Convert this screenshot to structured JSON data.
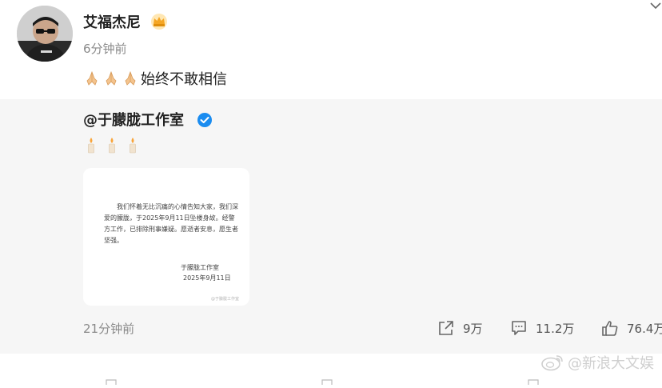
{
  "post": {
    "author": "艾福杰尼",
    "time": "6分钟前",
    "text": "始终不敢相信",
    "emoji_icons": [
      "folded-hands-icon",
      "folded-hands-icon",
      "folded-hands-icon"
    ]
  },
  "repost": {
    "author": "@于朦胧工作室",
    "candles": [
      "candle-icon",
      "candle-icon",
      "candle-icon"
    ],
    "card": {
      "body": "我们怀着无比沉痛的心情告知大家，我们深爱的朦胧，于2025年9月11日坠楼身故。经警方工作，已排除刑事嫌疑。愿逝者安息，愿生者坚强。",
      "signature": "于朦胧工作室",
      "date": "2025年9月11日",
      "watermark": "@于朦胧工作室"
    },
    "time": "21分钟前",
    "actions": {
      "share": "9万",
      "comment": "11.2万",
      "like": "76.4万"
    }
  },
  "watermark": {
    "text": "@新浪大文娱"
  },
  "colors": {
    "repost_bg": "#f6f6f6",
    "verified": "#1a8cf0",
    "muted_text": "#8a8a8a",
    "crown": "#f5a623"
  }
}
